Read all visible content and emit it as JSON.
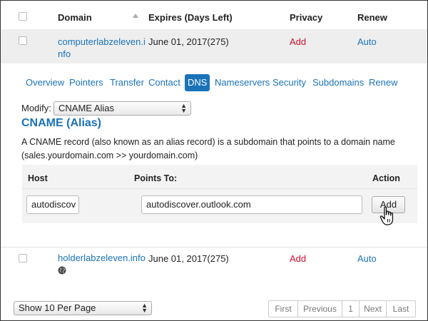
{
  "table": {
    "headers": {
      "domain": "Domain",
      "expires": "Expires (Days Left)",
      "privacy": "Privacy",
      "renew": "Renew"
    },
    "rows": [
      {
        "domain_line1": "computerlabzeleven.i",
        "domain_line2": "nfo",
        "expires": "June 01, 2017(275)",
        "privacy": "Add",
        "renew": "Auto"
      },
      {
        "domain": "holderlabzeleven.info",
        "expires": "June 01, 2017(275)",
        "privacy": "Add",
        "renew": "Auto"
      }
    ]
  },
  "tabs": [
    "Overview",
    "Pointers",
    "Transfer",
    "Contact",
    "DNS",
    "Nameservers",
    "Security",
    "Subdomains",
    "Renew"
  ],
  "active_tab": "DNS",
  "modify": {
    "label": "Modify:",
    "selected": "CNAME Alias"
  },
  "cname": {
    "title": "CNAME (Alias)",
    "desc_line1": "A CNAME record (also known as an alias record) is a subdomain that points to a domain name",
    "desc_line2": "(sales.yourdomain.com >> yourdomain.com)"
  },
  "form": {
    "host_header": "Host",
    "points_header": "Points To:",
    "action_header": "Action",
    "host_value": "autodiscov",
    "points_value": "autodiscover.outlook.com",
    "add_button": "Add"
  },
  "footer": {
    "per_page": "Show 10 Per Page",
    "pager": [
      "First",
      "Previous",
      "1",
      "Next",
      "Last"
    ]
  },
  "colors": {
    "link": "#1a73b8",
    "red": "#c8102e",
    "active_tab": "#1a73b8"
  },
  "icons": [
    "globe-icon",
    "pointer-hand-icon",
    "sort-arrow-icon"
  ]
}
